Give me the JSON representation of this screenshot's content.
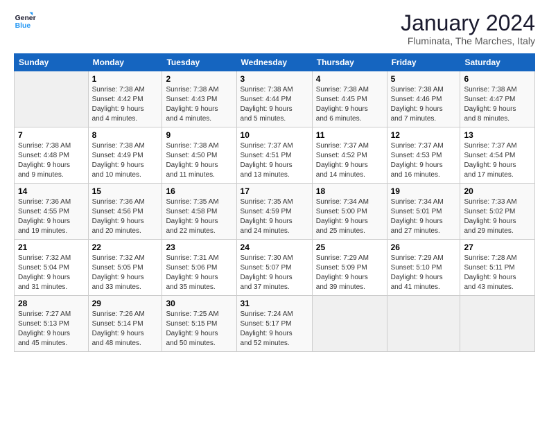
{
  "header": {
    "logo_line1": "General",
    "logo_line2": "Blue",
    "month_title": "January 2024",
    "location": "Fluminata, The Marches, Italy"
  },
  "calendar": {
    "days_of_week": [
      "Sunday",
      "Monday",
      "Tuesday",
      "Wednesday",
      "Thursday",
      "Friday",
      "Saturday"
    ],
    "weeks": [
      [
        {
          "day": "",
          "detail": ""
        },
        {
          "day": "1",
          "detail": "Sunrise: 7:38 AM\nSunset: 4:42 PM\nDaylight: 9 hours\nand 4 minutes."
        },
        {
          "day": "2",
          "detail": "Sunrise: 7:38 AM\nSunset: 4:43 PM\nDaylight: 9 hours\nand 4 minutes."
        },
        {
          "day": "3",
          "detail": "Sunrise: 7:38 AM\nSunset: 4:44 PM\nDaylight: 9 hours\nand 5 minutes."
        },
        {
          "day": "4",
          "detail": "Sunrise: 7:38 AM\nSunset: 4:45 PM\nDaylight: 9 hours\nand 6 minutes."
        },
        {
          "day": "5",
          "detail": "Sunrise: 7:38 AM\nSunset: 4:46 PM\nDaylight: 9 hours\nand 7 minutes."
        },
        {
          "day": "6",
          "detail": "Sunrise: 7:38 AM\nSunset: 4:47 PM\nDaylight: 9 hours\nand 8 minutes."
        }
      ],
      [
        {
          "day": "7",
          "detail": "Sunrise: 7:38 AM\nSunset: 4:48 PM\nDaylight: 9 hours\nand 9 minutes."
        },
        {
          "day": "8",
          "detail": "Sunrise: 7:38 AM\nSunset: 4:49 PM\nDaylight: 9 hours\nand 10 minutes."
        },
        {
          "day": "9",
          "detail": "Sunrise: 7:38 AM\nSunset: 4:50 PM\nDaylight: 9 hours\nand 11 minutes."
        },
        {
          "day": "10",
          "detail": "Sunrise: 7:37 AM\nSunset: 4:51 PM\nDaylight: 9 hours\nand 13 minutes."
        },
        {
          "day": "11",
          "detail": "Sunrise: 7:37 AM\nSunset: 4:52 PM\nDaylight: 9 hours\nand 14 minutes."
        },
        {
          "day": "12",
          "detail": "Sunrise: 7:37 AM\nSunset: 4:53 PM\nDaylight: 9 hours\nand 16 minutes."
        },
        {
          "day": "13",
          "detail": "Sunrise: 7:37 AM\nSunset: 4:54 PM\nDaylight: 9 hours\nand 17 minutes."
        }
      ],
      [
        {
          "day": "14",
          "detail": "Sunrise: 7:36 AM\nSunset: 4:55 PM\nDaylight: 9 hours\nand 19 minutes."
        },
        {
          "day": "15",
          "detail": "Sunrise: 7:36 AM\nSunset: 4:56 PM\nDaylight: 9 hours\nand 20 minutes."
        },
        {
          "day": "16",
          "detail": "Sunrise: 7:35 AM\nSunset: 4:58 PM\nDaylight: 9 hours\nand 22 minutes."
        },
        {
          "day": "17",
          "detail": "Sunrise: 7:35 AM\nSunset: 4:59 PM\nDaylight: 9 hours\nand 24 minutes."
        },
        {
          "day": "18",
          "detail": "Sunrise: 7:34 AM\nSunset: 5:00 PM\nDaylight: 9 hours\nand 25 minutes."
        },
        {
          "day": "19",
          "detail": "Sunrise: 7:34 AM\nSunset: 5:01 PM\nDaylight: 9 hours\nand 27 minutes."
        },
        {
          "day": "20",
          "detail": "Sunrise: 7:33 AM\nSunset: 5:02 PM\nDaylight: 9 hours\nand 29 minutes."
        }
      ],
      [
        {
          "day": "21",
          "detail": "Sunrise: 7:32 AM\nSunset: 5:04 PM\nDaylight: 9 hours\nand 31 minutes."
        },
        {
          "day": "22",
          "detail": "Sunrise: 7:32 AM\nSunset: 5:05 PM\nDaylight: 9 hours\nand 33 minutes."
        },
        {
          "day": "23",
          "detail": "Sunrise: 7:31 AM\nSunset: 5:06 PM\nDaylight: 9 hours\nand 35 minutes."
        },
        {
          "day": "24",
          "detail": "Sunrise: 7:30 AM\nSunset: 5:07 PM\nDaylight: 9 hours\nand 37 minutes."
        },
        {
          "day": "25",
          "detail": "Sunrise: 7:29 AM\nSunset: 5:09 PM\nDaylight: 9 hours\nand 39 minutes."
        },
        {
          "day": "26",
          "detail": "Sunrise: 7:29 AM\nSunset: 5:10 PM\nDaylight: 9 hours\nand 41 minutes."
        },
        {
          "day": "27",
          "detail": "Sunrise: 7:28 AM\nSunset: 5:11 PM\nDaylight: 9 hours\nand 43 minutes."
        }
      ],
      [
        {
          "day": "28",
          "detail": "Sunrise: 7:27 AM\nSunset: 5:13 PM\nDaylight: 9 hours\nand 45 minutes."
        },
        {
          "day": "29",
          "detail": "Sunrise: 7:26 AM\nSunset: 5:14 PM\nDaylight: 9 hours\nand 48 minutes."
        },
        {
          "day": "30",
          "detail": "Sunrise: 7:25 AM\nSunset: 5:15 PM\nDaylight: 9 hours\nand 50 minutes."
        },
        {
          "day": "31",
          "detail": "Sunrise: 7:24 AM\nSunset: 5:17 PM\nDaylight: 9 hours\nand 52 minutes."
        },
        {
          "day": "",
          "detail": ""
        },
        {
          "day": "",
          "detail": ""
        },
        {
          "day": "",
          "detail": ""
        }
      ]
    ]
  }
}
